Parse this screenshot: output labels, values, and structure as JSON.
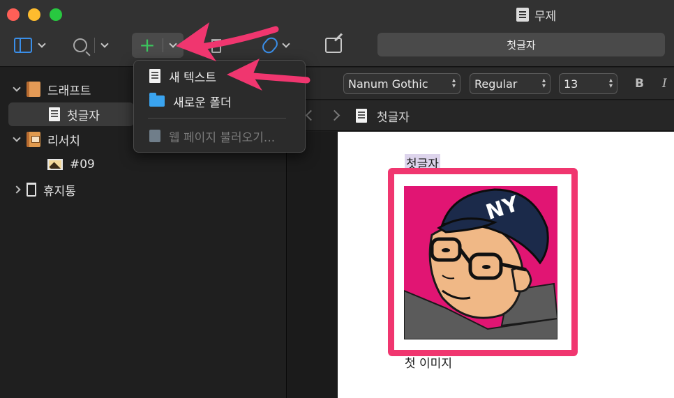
{
  "window": {
    "title": "무제"
  },
  "toolbar": {
    "doc_tab_label": "첫글자"
  },
  "sidebar": {
    "items": [
      {
        "label": "드래프트",
        "icon": "draft-book-icon"
      },
      {
        "label": "첫글자",
        "icon": "text-document-icon",
        "selected": true
      },
      {
        "label": "리서치",
        "icon": "research-book-icon"
      },
      {
        "label": "#09",
        "icon": "image-icon"
      },
      {
        "label": "휴지통",
        "icon": "trash-icon"
      }
    ]
  },
  "add_menu": {
    "items": [
      {
        "label": "새 텍스트",
        "icon": "text-document-icon",
        "enabled": true
      },
      {
        "label": "새로운 폴더",
        "icon": "folder-icon",
        "enabled": true
      },
      {
        "label": "웹 페이지 불러오기...",
        "icon": "web-page-icon",
        "enabled": false
      }
    ]
  },
  "format_bar": {
    "partial_style": "lia",
    "font_family": "Nanum Gothic",
    "font_weight": "Regular",
    "font_size": "13",
    "bold": "B",
    "italic": "I"
  },
  "path_bar": {
    "current": "첫글자"
  },
  "document": {
    "heading": "첫글자",
    "caption": "첫 이미지"
  },
  "colors": {
    "highlight_frame": "#f0366f",
    "annotation_arrow": "#f0366f",
    "accent_blue": "#3a8ee8",
    "add_green": "#3cc45d"
  }
}
